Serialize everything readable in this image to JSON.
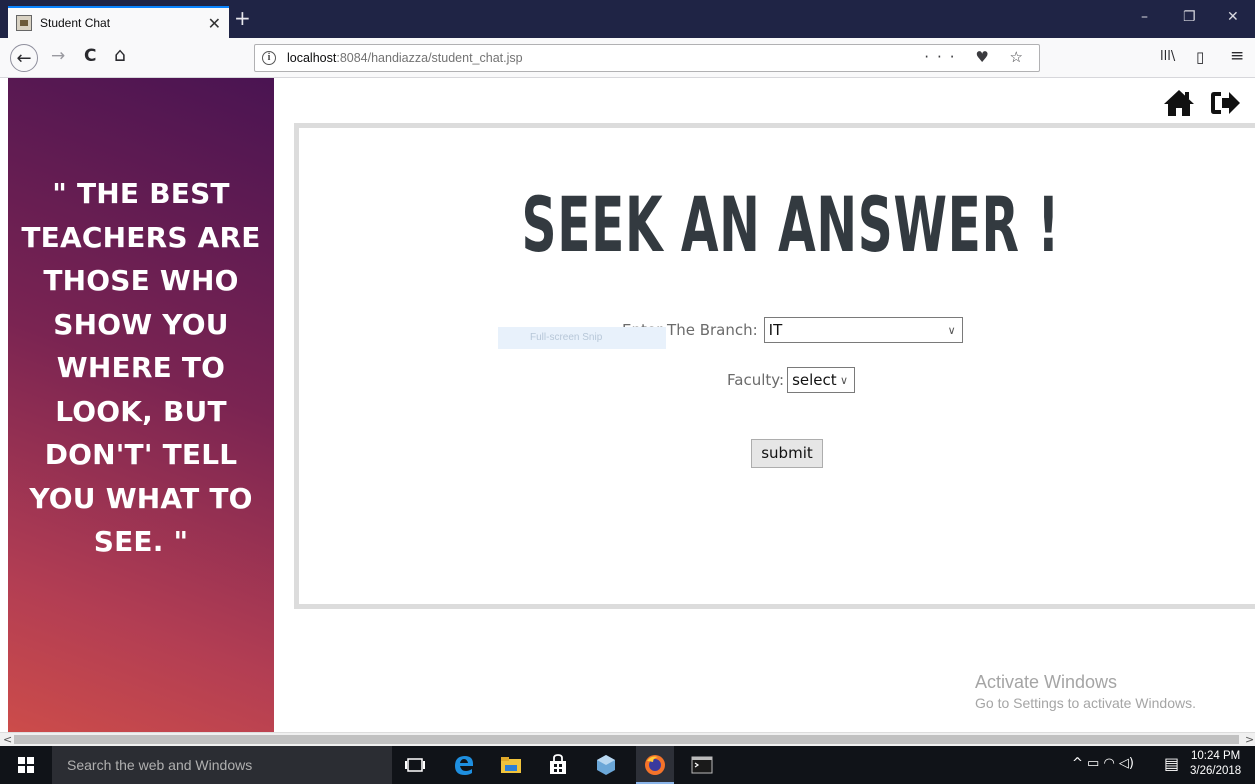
{
  "browser": {
    "tab_title": "Student Chat",
    "tab_close": "✕",
    "new_tab": "+",
    "url_host": "localhost",
    "url_rest": ":8084/handiazza/student_chat.jsp",
    "url_info": "i",
    "url_actions": "··· ♥ ☆",
    "window": {
      "minimize": "–",
      "restore": "❐",
      "close": "✕"
    },
    "nav": {
      "back": "←",
      "forward": "→",
      "reload": "C",
      "home": "⌂"
    },
    "toolbar": {
      "library": "lll\\",
      "sidebar": "▯",
      "menu": "≡"
    }
  },
  "sidebar": {
    "quote": "\" THE BEST TEACHERS ARE THOSE WHO SHOW YOU WHERE TO LOOK, BUT DON'T' TELL YOU WHAT TO SEE. \""
  },
  "header_icons": {
    "home": "home-icon",
    "logout": "sign-out-icon"
  },
  "main": {
    "heading": "SEEK AN ANSWER !",
    "branch_label": "Enter The Branch:",
    "branch_value": "IT",
    "faculty_label": "Faculty:",
    "faculty_value": "select",
    "submit_label": "submit"
  },
  "overlay": {
    "snip_label": "Full-screen Snip"
  },
  "watermark": {
    "title": "Activate Windows",
    "subtitle": "Go to Settings to activate Windows."
  },
  "scrollbar": {
    "left": "<",
    "right": ">"
  },
  "taskbar": {
    "search_placeholder": "Search the web and Windows",
    "time": "10:24 PM",
    "date": "3/26/2018",
    "tray_icons": "^ ▭ ◠ ◁)",
    "notification": "▤"
  },
  "colors": {
    "sidebar_top": "#4a1452",
    "sidebar_bottom": "#cc4c4a",
    "heading": "#333a40",
    "tabstrip": "#1f2445",
    "taskbar": "#101318"
  }
}
